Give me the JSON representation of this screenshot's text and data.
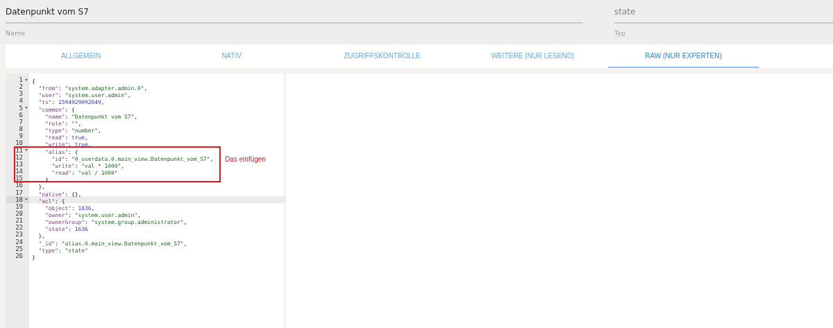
{
  "fields": [
    {
      "label": "Name",
      "value": "Datenpunkt vom S7"
    },
    {
      "label": "Typ",
      "value": "state"
    }
  ],
  "tabs": [
    {
      "label": "ALLGEMEIN",
      "selected": false
    },
    {
      "label": "NATIV",
      "selected": false
    },
    {
      "label": "ZUGRIFFSKONTROLLE",
      "selected": false
    },
    {
      "label": "WEITERE (NUR LESEND)",
      "selected": false
    },
    {
      "label": "RAW (NUR EXPERTEN)",
      "selected": true
    }
  ],
  "editor": {
    "lines": [
      {
        "number": "1",
        "foldable": true,
        "active": false,
        "tokens": [
          {
            "kind": "punct",
            "text": "{"
          }
        ]
      },
      {
        "number": "2",
        "foldable": false,
        "active": false,
        "tokens": [
          {
            "kind": "key",
            "text": "  \"from\""
          },
          {
            "kind": "punct",
            "text": ": "
          },
          {
            "kind": "string",
            "text": "\"system.adapter.admin.0\""
          },
          {
            "kind": "punct",
            "text": ","
          }
        ]
      },
      {
        "number": "3",
        "foldable": false,
        "active": false,
        "tokens": [
          {
            "kind": "key",
            "text": "  \"user\""
          },
          {
            "kind": "punct",
            "text": ": "
          },
          {
            "kind": "string",
            "text": "\"system.user.admin\""
          },
          {
            "kind": "punct",
            "text": ","
          }
        ]
      },
      {
        "number": "4",
        "foldable": false,
        "active": false,
        "tokens": [
          {
            "kind": "key",
            "text": "  \"ts\""
          },
          {
            "kind": "punct",
            "text": ": "
          },
          {
            "kind": "number",
            "text": "1594929092649"
          },
          {
            "kind": "punct",
            "text": ","
          }
        ]
      },
      {
        "number": "5",
        "foldable": true,
        "active": false,
        "tokens": [
          {
            "kind": "key",
            "text": "  \"common\""
          },
          {
            "kind": "punct",
            "text": ": {"
          }
        ]
      },
      {
        "number": "6",
        "foldable": false,
        "active": false,
        "tokens": [
          {
            "kind": "key",
            "text": "    \"name\""
          },
          {
            "kind": "punct",
            "text": ": "
          },
          {
            "kind": "string",
            "text": "\"Datenpunkt vom S7\""
          },
          {
            "kind": "punct",
            "text": ","
          }
        ]
      },
      {
        "number": "7",
        "foldable": false,
        "active": false,
        "tokens": [
          {
            "kind": "key",
            "text": "    \"role\""
          },
          {
            "kind": "punct",
            "text": ": "
          },
          {
            "kind": "string",
            "text": "\"\""
          },
          {
            "kind": "punct",
            "text": ","
          }
        ]
      },
      {
        "number": "8",
        "foldable": false,
        "active": false,
        "tokens": [
          {
            "kind": "key",
            "text": "    \"type\""
          },
          {
            "kind": "punct",
            "text": ": "
          },
          {
            "kind": "string",
            "text": "\"number\""
          },
          {
            "kind": "punct",
            "text": ","
          }
        ]
      },
      {
        "number": "9",
        "foldable": false,
        "active": false,
        "tokens": [
          {
            "kind": "key",
            "text": "    \"read\""
          },
          {
            "kind": "punct",
            "text": ": "
          },
          {
            "kind": "number",
            "text": "true"
          },
          {
            "kind": "punct",
            "text": ","
          }
        ]
      },
      {
        "number": "10",
        "foldable": false,
        "active": false,
        "tokens": [
          {
            "kind": "key",
            "text": "    \"write\""
          },
          {
            "kind": "punct",
            "text": ": "
          },
          {
            "kind": "number",
            "text": "true"
          },
          {
            "kind": "punct",
            "text": ","
          }
        ]
      },
      {
        "number": "11",
        "foldable": true,
        "active": false,
        "tokens": [
          {
            "kind": "key",
            "text": "    \"alias\""
          },
          {
            "kind": "punct",
            "text": ": {"
          }
        ]
      },
      {
        "number": "12",
        "foldable": false,
        "active": false,
        "tokens": [
          {
            "kind": "key",
            "text": "      \"id\""
          },
          {
            "kind": "punct",
            "text": ": "
          },
          {
            "kind": "string",
            "text": "\"0_userdata.0.main_view.Datenpunkt_vom_S7\""
          },
          {
            "kind": "punct",
            "text": ","
          }
        ]
      },
      {
        "number": "13",
        "foldable": false,
        "active": false,
        "tokens": [
          {
            "kind": "key",
            "text": "      \"write\""
          },
          {
            "kind": "punct",
            "text": ": "
          },
          {
            "kind": "string",
            "text": "\"val * 1000\""
          },
          {
            "kind": "punct",
            "text": ","
          }
        ]
      },
      {
        "number": "14",
        "foldable": false,
        "active": false,
        "tokens": [
          {
            "kind": "key",
            "text": "      \"read\""
          },
          {
            "kind": "punct",
            "text": ": "
          },
          {
            "kind": "string",
            "text": "\"val / 1000\""
          }
        ]
      },
      {
        "number": "15",
        "foldable": false,
        "active": false,
        "tokens": [
          {
            "kind": "punct",
            "text": "    }"
          }
        ]
      },
      {
        "number": "16",
        "foldable": false,
        "active": false,
        "tokens": [
          {
            "kind": "punct",
            "text": "  },"
          }
        ]
      },
      {
        "number": "17",
        "foldable": false,
        "active": false,
        "tokens": [
          {
            "kind": "key",
            "text": "  \"native\""
          },
          {
            "kind": "punct",
            "text": ": {},"
          }
        ]
      },
      {
        "number": "18",
        "foldable": true,
        "active": true,
        "tokens": [
          {
            "kind": "key",
            "text": "  \"acl\""
          },
          {
            "kind": "punct",
            "text": ": {"
          }
        ]
      },
      {
        "number": "19",
        "foldable": false,
        "active": false,
        "tokens": [
          {
            "kind": "key",
            "text": "    \"object\""
          },
          {
            "kind": "punct",
            "text": ": "
          },
          {
            "kind": "number",
            "text": "1636"
          },
          {
            "kind": "punct",
            "text": ","
          }
        ]
      },
      {
        "number": "20",
        "foldable": false,
        "active": false,
        "tokens": [
          {
            "kind": "key",
            "text": "    \"owner\""
          },
          {
            "kind": "punct",
            "text": ": "
          },
          {
            "kind": "string",
            "text": "\"system.user.admin\""
          },
          {
            "kind": "punct",
            "text": ","
          }
        ]
      },
      {
        "number": "21",
        "foldable": false,
        "active": false,
        "tokens": [
          {
            "kind": "key",
            "text": "    \"ownerGroup\""
          },
          {
            "kind": "punct",
            "text": ": "
          },
          {
            "kind": "string",
            "text": "\"system.group.administrator\""
          },
          {
            "kind": "punct",
            "text": ","
          }
        ]
      },
      {
        "number": "22",
        "foldable": false,
        "active": false,
        "tokens": [
          {
            "kind": "key",
            "text": "    \"state\""
          },
          {
            "kind": "punct",
            "text": ": "
          },
          {
            "kind": "number",
            "text": "1636"
          }
        ]
      },
      {
        "number": "23",
        "foldable": false,
        "active": false,
        "tokens": [
          {
            "kind": "punct",
            "text": "  },"
          }
        ]
      },
      {
        "number": "24",
        "foldable": false,
        "active": false,
        "tokens": [
          {
            "kind": "key",
            "text": "  \"_id\""
          },
          {
            "kind": "punct",
            "text": ": "
          },
          {
            "kind": "string",
            "text": "\"alias.0.main_view.Datenpunkt_vom_S7\""
          },
          {
            "kind": "punct",
            "text": ","
          }
        ]
      },
      {
        "number": "25",
        "foldable": false,
        "active": false,
        "tokens": [
          {
            "kind": "key",
            "text": "  \"type\""
          },
          {
            "kind": "punct",
            "text": ": "
          },
          {
            "kind": "string",
            "text": "\"state\""
          }
        ]
      },
      {
        "number": "26",
        "foldable": false,
        "active": false,
        "tokens": [
          {
            "kind": "punct",
            "text": "}"
          }
        ]
      }
    ]
  },
  "annotation": {
    "text": "Das einfügen"
  }
}
